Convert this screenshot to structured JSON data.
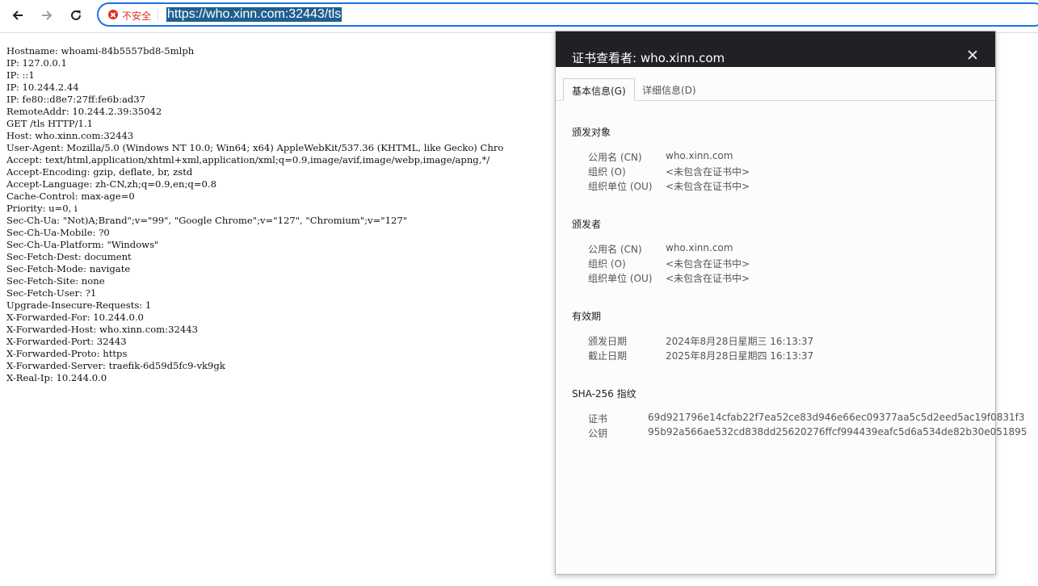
{
  "browser": {
    "security_label": "不安全",
    "url": "https://who.xinn.com:32443/tls"
  },
  "page_lines": [
    "Hostname: whoami-84b5557bd8-5mlph",
    "IP: 127.0.0.1",
    "IP: ::1",
    "IP: 10.244.2.44",
    "IP: fe80::d8e7:27ff:fe6b:ad37",
    "RemoteAddr: 10.244.2.39:35042",
    "GET /tls HTTP/1.1",
    "Host: who.xinn.com:32443",
    "User-Agent: Mozilla/5.0 (Windows NT 10.0; Win64; x64) AppleWebKit/537.36 (KHTML, like Gecko) Chro",
    "Accept: text/html,application/xhtml+xml,application/xml;q=0.9,image/avif,image/webp,image/apng,*/",
    "Accept-Encoding: gzip, deflate, br, zstd",
    "Accept-Language: zh-CN,zh;q=0.9,en;q=0.8",
    "Cache-Control: max-age=0",
    "Priority: u=0, i",
    "Sec-Ch-Ua: \"Not)A;Brand\";v=\"99\", \"Google Chrome\";v=\"127\", \"Chromium\";v=\"127\"",
    "Sec-Ch-Ua-Mobile: ?0",
    "Sec-Ch-Ua-Platform: \"Windows\"",
    "Sec-Fetch-Dest: document",
    "Sec-Fetch-Mode: navigate",
    "Sec-Fetch-Site: none",
    "Sec-Fetch-User: ?1",
    "Upgrade-Insecure-Requests: 1",
    "X-Forwarded-For: 10.244.0.0",
    "X-Forwarded-Host: who.xinn.com:32443",
    "X-Forwarded-Port: 32443",
    "X-Forwarded-Proto: https",
    "X-Forwarded-Server: traefik-6d59d5fc9-vk9gk",
    "X-Real-Ip: 10.244.0.0"
  ],
  "cert": {
    "title": "证书查看者: who.xinn.com",
    "tab_basic": "基本信息(G)",
    "tab_detail": "详细信息(D)",
    "subject": {
      "title": "颁发对象",
      "cn_label": "公用名 (CN)",
      "cn_value": "who.xinn.com",
      "o_label": "组织 (O)",
      "o_value": "<未包含在证书中>",
      "ou_label": "组织单位 (OU)",
      "ou_value": "<未包含在证书中>"
    },
    "issuer": {
      "title": "颁发者",
      "cn_label": "公用名 (CN)",
      "cn_value": "who.xinn.com",
      "o_label": "组织 (O)",
      "o_value": "<未包含在证书中>",
      "ou_label": "组织单位 (OU)",
      "ou_value": "<未包含在证书中>"
    },
    "validity": {
      "title": "有效期",
      "issued_label": "颁发日期",
      "issued_value": "2024年8月28日星期三 16:13:37",
      "expires_label": "截止日期",
      "expires_value": "2025年8月28日星期四 16:13:37"
    },
    "fingerprints": {
      "title": "SHA-256 指纹",
      "cert_label": "证书",
      "cert_value": "69d921796e14cfab22f7ea52ce83d946e66ec09377aa5c5d2eed5ac19f0831f3",
      "key_label": "公钥",
      "key_value": "95b92a566ae532cd838dd25620276ffcf994439eafc5d6a534de82b30e051895"
    }
  }
}
